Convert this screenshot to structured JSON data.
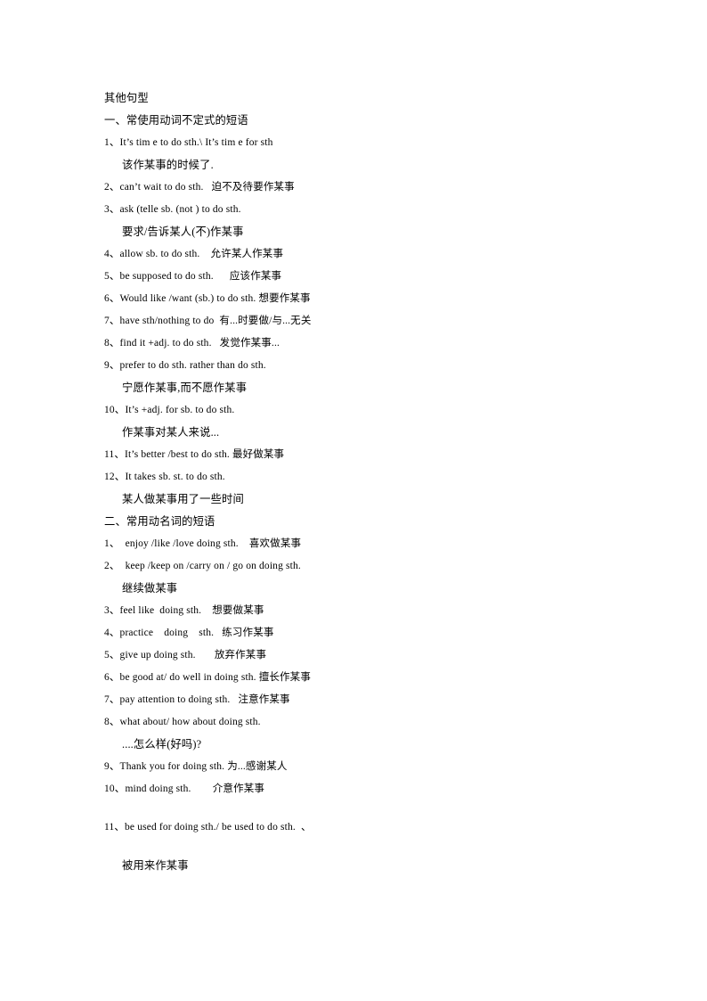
{
  "document": {
    "title": "其他句型",
    "sections": [
      {
        "heading": "一、常使用动词不定式的短语",
        "lines": [
          {
            "text": "1、It’s tim e to do sth.\\ It’s tim e for sth",
            "style": "latin"
          },
          {
            "text": "该作某事的时候了.",
            "style": "cjk-indent"
          },
          {
            "text": "2、can’t wait to do sth.   迫不及待要作某事",
            "style": "latin"
          },
          {
            "text": "3、ask (telle sb. (not ) to do sth.",
            "style": "latin"
          },
          {
            "text": "要求/告诉某人(不)作某事",
            "style": "cjk-indent"
          },
          {
            "text": "4、allow sb. to do sth.    允许某人作某事",
            "style": "latin"
          },
          {
            "text": "5、be supposed to do sth.      应该作某事",
            "style": "latin"
          },
          {
            "text": "6、Would like /want (sb.) to do sth. 想要作某事",
            "style": "latin"
          },
          {
            "text": "7、have sth/nothing to do  有...时要做/与...无关",
            "style": "latin"
          },
          {
            "text": "8、find it +adj. to do sth.   发觉作某事...",
            "style": "latin"
          },
          {
            "text": "9、prefer to do sth. rather than do sth.",
            "style": "latin"
          },
          {
            "text": "宁愿作某事,而不愿作某事",
            "style": "cjk-indent"
          },
          {
            "text": "10、It’s +adj. for sb. to do sth.",
            "style": "latin"
          },
          {
            "text": "作某事对某人来说...",
            "style": "cjk-indent"
          },
          {
            "text": "11、It’s better /best to do sth. 最好做某事",
            "style": "latin"
          },
          {
            "text": "12、It takes sb. st. to do sth.",
            "style": "latin"
          },
          {
            "text": "某人做某事用了一些时间",
            "style": "cjk-indent"
          }
        ]
      },
      {
        "heading": "二、常用动名词的短语",
        "lines": [
          {
            "text": "1、  enjoy /like /love doing sth.    喜欢做某事",
            "style": "latin"
          },
          {
            "text": "2、  keep /keep on /carry on / go on doing sth.",
            "style": "latin"
          },
          {
            "text": "继续做某事",
            "style": "cjk-indent"
          },
          {
            "text": "3、feel like  doing sth.    想要做某事",
            "style": "latin"
          },
          {
            "text": "4、practice    doing    sth.   练习作某事",
            "style": "latin"
          },
          {
            "text": "5、give up doing sth.       放弃作某事",
            "style": "latin"
          },
          {
            "text": "6、be good at/ do well in doing sth. 擅长作某事",
            "style": "latin"
          },
          {
            "text": "7、pay attention to doing sth.   注意作某事",
            "style": "latin"
          },
          {
            "text": "8、what about/ how about doing sth.",
            "style": "latin"
          },
          {
            "text": "....怎么样(好吗)?",
            "style": "cjk-indent"
          },
          {
            "text": "9、Thank you for doing sth. 为...感谢某人",
            "style": "latin"
          },
          {
            "text": "10、mind doing sth.        介意作某事",
            "style": "latin"
          },
          {
            "text": "",
            "style": "spacer"
          },
          {
            "text": "11、be used for doing sth./ be used to do sth.  、",
            "style": "latin"
          },
          {
            "text": "被用来作某事",
            "style": "cjk-indent-gap"
          }
        ]
      }
    ]
  }
}
